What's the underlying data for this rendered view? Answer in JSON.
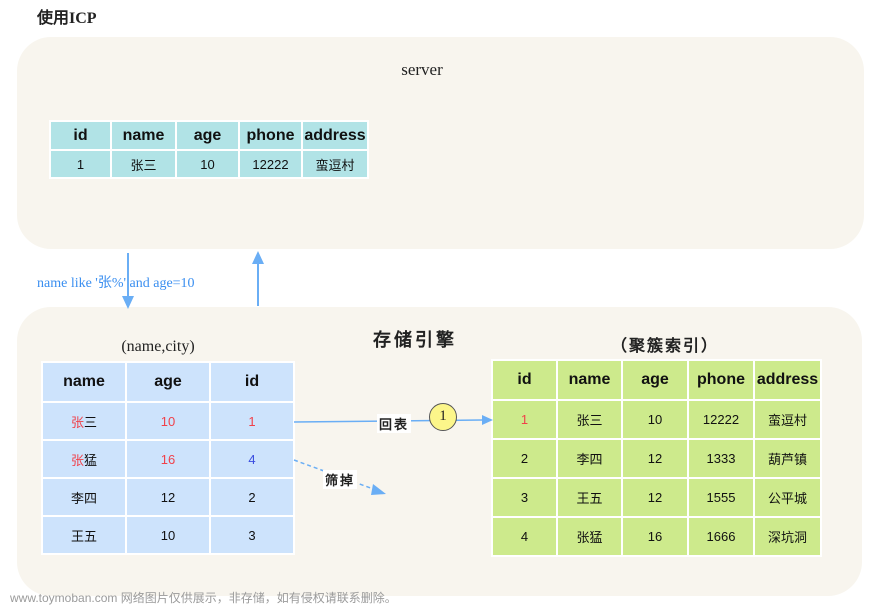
{
  "title": "使用ICP",
  "server": {
    "label": "server",
    "table": {
      "headers": [
        "id",
        "name",
        "age",
        "phone",
        "address"
      ],
      "rows": [
        [
          "1",
          "张三",
          "10",
          "12222",
          "蛮逗村"
        ]
      ]
    }
  },
  "query": {
    "condition": "name like '张%' and age=10"
  },
  "engine": {
    "label": "存储引擎",
    "index": {
      "label": "(name,city)",
      "headers": [
        "name",
        "age",
        "id"
      ],
      "rows": [
        {
          "name_prefix": "张",
          "name_rest": "三",
          "age": "10",
          "id": "1",
          "age_color": "red",
          "id_color": "red"
        },
        {
          "name_prefix": "张",
          "name_rest": "猛",
          "age": "16",
          "id": "4",
          "age_color": "red",
          "id_color": "blue"
        },
        {
          "name_prefix": "",
          "name_rest": "李四",
          "age": "12",
          "id": "2",
          "age_color": "",
          "id_color": ""
        },
        {
          "name_prefix": "",
          "name_rest": "王五",
          "age": "10",
          "id": "3",
          "age_color": "",
          "id_color": ""
        }
      ]
    },
    "clustered": {
      "label": "（聚簇索引）",
      "headers": [
        "id",
        "name",
        "age",
        "phone",
        "address"
      ],
      "rows": [
        [
          "1",
          "张三",
          "10",
          "12222",
          "蛮逗村"
        ],
        [
          "2",
          "李四",
          "12",
          "1333",
          "葫芦镇"
        ],
        [
          "3",
          "王五",
          "12",
          "1555",
          "公平城"
        ],
        [
          "4",
          "张猛",
          "16",
          "1666",
          "深坑洞"
        ]
      ]
    },
    "back_to_table_label": "回表",
    "step_number": "1",
    "filtered_label": "筛掉"
  },
  "colors": {
    "panel": "#f8f5ee",
    "server_table": "#b1e3e6",
    "index_table": "#cde3fc",
    "clustered_table": "#cdea8c",
    "arrow": "#6aaef5",
    "highlight_red": "#f0414a",
    "highlight_blue": "#3a4de0",
    "step_circle": "#fcf68a"
  },
  "watermark": "www.toymoban.com 网络图片仅供展示，非存储，如有侵权请联系删除。"
}
